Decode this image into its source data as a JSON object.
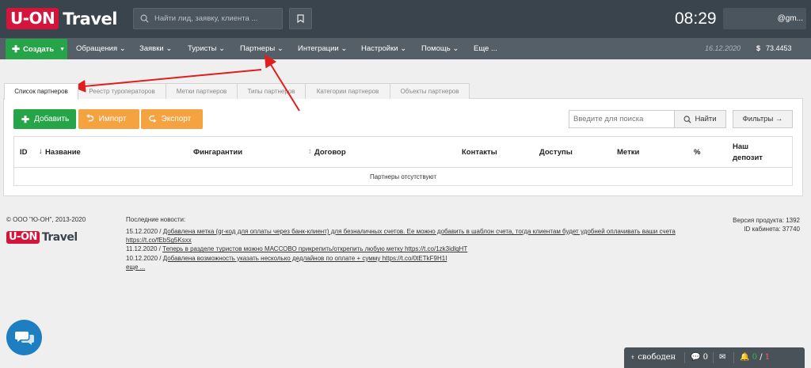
{
  "header": {
    "logo_box": "U-ON",
    "logo_text": "Travel",
    "search_placeholder": "Найти лид, заявку, клиента ...",
    "clock": "08:29",
    "user": "@gm..."
  },
  "nav": {
    "create": "Создать",
    "items": [
      "Обращения",
      "Заявки",
      "Туристы",
      "Партнеры",
      "Интеграции",
      "Настройки",
      "Помощь",
      "Еще ..."
    ],
    "date": "16.12.2020",
    "currency": "$",
    "balance": "73.4453"
  },
  "tabs": [
    "Список партнеров",
    "Реестр туроператоров",
    "Метки партнеров",
    "Типы партнеров",
    "Категории партнеров",
    "Объекты партнеров"
  ],
  "actions": {
    "add": "Добавить",
    "import": "Импорт",
    "export": "Экспорт",
    "search_placeholder": "Введите для поиска",
    "find": "Найти",
    "filters": "Фильтры →"
  },
  "table": {
    "columns": [
      "ID",
      "Название",
      "Фингарантии",
      "Договор",
      "Контакты",
      "Доступы",
      "Метки",
      "%",
      "Наш",
      "депозит"
    ],
    "empty": "Партнеры отсутствуют"
  },
  "footer": {
    "copyright": "© ООО \"Ю-ОН\", 2013-2020",
    "news_title": "Последние новости:",
    "news": [
      {
        "date": "15.12.2020 /",
        "text": "Добавлена метка (qr-код для оплаты через банк-клиент) для безналичных счетов. Ее можно добавить в шаблон счета, тогда клиентам будет удобней оплачивать ваши счета https://t.co/fEbSg5Ksxx"
      },
      {
        "date": "11.12.2020 /",
        "text": "Теперь в разделе туристов можно МАССОВО прикрепить/открепить любую метку https://t.co/1zk3idlqHT"
      },
      {
        "date": "10.12.2020 /",
        "text": "Добавлена возможность указать несколько дедлайнов по оплате + сумму https://t.co/0tETkF9H1I"
      }
    ],
    "more": "еще ...",
    "version": "Версия продукта: 1392",
    "cabinet": "ID кабинета: 37740"
  },
  "statusbar": {
    "status": "свободен",
    "chats": "0",
    "notif_new": "0",
    "notif_total": "1"
  },
  "colors": {
    "header_bg": "#3a444d",
    "nav_bg": "#555f68",
    "green": "#26a548",
    "orange": "#f5a341",
    "brand_red": "#d4143a",
    "arrow_red": "#e01e1e",
    "chat_blue": "#1d7fc2"
  }
}
